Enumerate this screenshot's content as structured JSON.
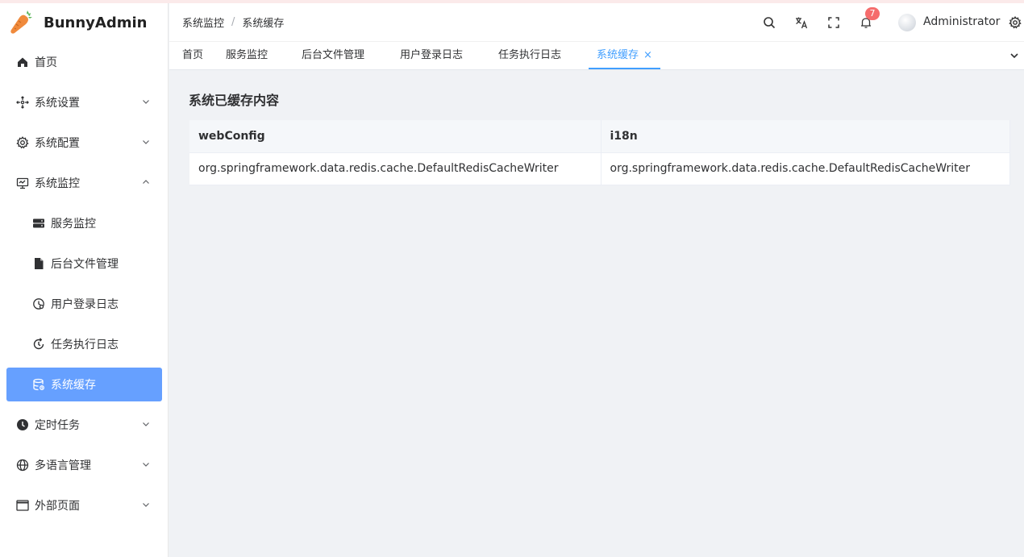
{
  "app": {
    "name": "BunnyAdmin"
  },
  "sidebar": {
    "items": [
      {
        "label": "首页",
        "icon": "home-icon"
      },
      {
        "label": "系统设置",
        "icon": "settings-arrows-icon",
        "expandable": true,
        "expanded": false
      },
      {
        "label": "系统配置",
        "icon": "gear-icon",
        "expandable": true,
        "expanded": false
      },
      {
        "label": "系统监控",
        "icon": "monitor-icon",
        "expandable": true,
        "expanded": true
      },
      {
        "label": "服务监控",
        "icon": "server-icon",
        "sub": true
      },
      {
        "label": "后台文件管理",
        "icon": "file-icon",
        "sub": true
      },
      {
        "label": "用户登录日志",
        "icon": "clock-icon",
        "sub": true
      },
      {
        "label": "任务执行日志",
        "icon": "refresh-clock-icon",
        "sub": true
      },
      {
        "label": "系统缓存",
        "icon": "database-icon",
        "sub": true,
        "active": true
      },
      {
        "label": "定时任务",
        "icon": "timer-icon",
        "expandable": true,
        "expanded": false
      },
      {
        "label": "多语言管理",
        "icon": "globe-icon",
        "expandable": true,
        "expanded": false
      },
      {
        "label": "外部页面",
        "icon": "window-icon",
        "expandable": true,
        "expanded": false
      }
    ]
  },
  "header": {
    "breadcrumb": [
      "系统监控",
      "系统缓存"
    ],
    "breadcrumb_separator": "/",
    "notification_count": "7",
    "username": "Administrator"
  },
  "tabs": [
    {
      "label": "首页"
    },
    {
      "label": "服务监控"
    },
    {
      "label": "后台文件管理"
    },
    {
      "label": "用户登录日志"
    },
    {
      "label": "任务执行日志"
    },
    {
      "label": "系统缓存",
      "active": true,
      "close": "×"
    }
  ],
  "main": {
    "title": "系统已缓存内容",
    "table": {
      "headers": [
        "webConfig",
        "i18n"
      ],
      "rows": [
        [
          "org.springframework.data.redis.cache.DefaultRedisCacheWriter",
          "org.springframework.data.redis.cache.DefaultRedisCacheWriter"
        ]
      ]
    }
  },
  "colors": {
    "accent": "#409eff",
    "active_menu_bg": "#66a0ff",
    "badge": "#f56c6c"
  }
}
